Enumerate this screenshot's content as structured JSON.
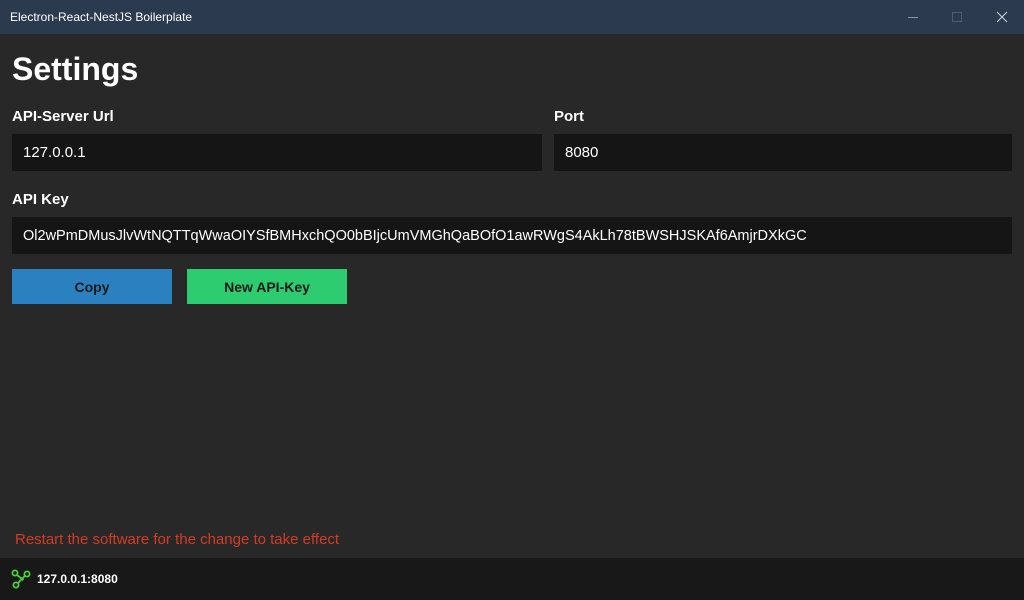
{
  "window": {
    "title": "Electron-React-NestJS Boilerplate",
    "controls": {
      "minimize_icon": "minimize-icon",
      "maximize_icon": "maximize-icon",
      "close_icon": "close-icon"
    }
  },
  "settings": {
    "title": "Settings",
    "api_server_url": {
      "label": "API-Server Url",
      "value": "127.0.0.1"
    },
    "port": {
      "label": "Port",
      "value": "8080"
    },
    "api_key": {
      "label": "API Key",
      "value": "Ol2wPmDMusJlvWtNQTTqWwaOIYSfBMHxchQO0bBIjcUmVMGhQaBOfO1awRWgS4AkLh78tBWSHJSKAf6AmjrDXkGC"
    },
    "buttons": {
      "copy": "Copy",
      "new_api_key": "New API-Key"
    },
    "restart_note": "Restart the software for the change to take effect"
  },
  "statusbar": {
    "icon": "connection-icon",
    "address": "127.0.0.1:8080"
  },
  "colors": {
    "titlebar": "#2b3a4e",
    "background": "#282828",
    "input": "#151515",
    "copy_button": "#2b80bf",
    "new_key_button": "#2ecc71",
    "warning_text": "#d33b24",
    "status_icon": "#4ccf3c",
    "statusbar": "#181818"
  }
}
